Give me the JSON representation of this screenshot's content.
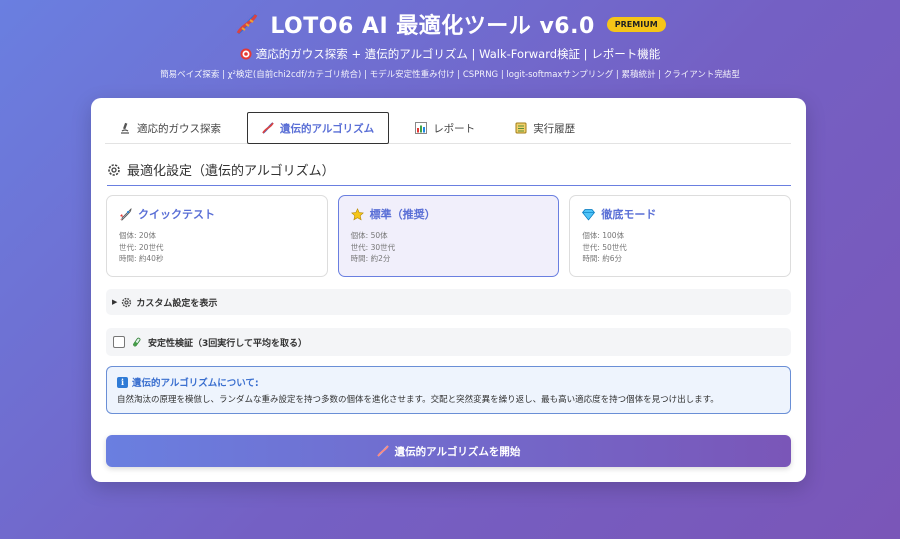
{
  "header": {
    "title": "LOTO6 AI 最適化ツール v6.0",
    "badge": "PREMIUM",
    "subtitle": "適応的ガウス探索 + 遺伝的アルゴリズム | Walk-Forward検証 | レポート機能",
    "features": "簡易ベイズ探索 | χ²検定(自前chi2cdf/カテゴリ統合) | モデル安定性重み付け | CSPRNG | logit-softmaxサンプリング | 累積統計 | クライアント完結型"
  },
  "tabs": [
    {
      "label": "適応的ガウス探索",
      "icon": "microscope-icon",
      "active": false
    },
    {
      "label": "遺伝的アルゴリズム",
      "icon": "dna-icon",
      "active": true
    },
    {
      "label": "レポート",
      "icon": "chart-icon",
      "active": false
    },
    {
      "label": "実行履歴",
      "icon": "ledger-icon",
      "active": false
    }
  ],
  "section": {
    "title": "最適化設定（遺伝的アルゴリズム）"
  },
  "modes": [
    {
      "title": "クイックテスト",
      "icon": "rocket-icon",
      "lines": [
        "個体: 20体",
        "世代: 20世代",
        "時間: 約40秒"
      ],
      "selected": false
    },
    {
      "title": "標準（推奨）",
      "icon": "star-icon",
      "lines": [
        "個体: 50体",
        "世代: 30世代",
        "時間: 約2分"
      ],
      "selected": true
    },
    {
      "title": "徹底モード",
      "icon": "gem-icon",
      "lines": [
        "個体: 100体",
        "世代: 50世代",
        "時間: 約6分"
      ],
      "selected": false
    }
  ],
  "custom": {
    "label": "カスタム設定を表示",
    "triangle": "▶"
  },
  "stability": {
    "label": "安定性検証（3回実行して平均を取る）",
    "checked": false
  },
  "info": {
    "title": "遺伝的アルゴリズムについて:",
    "icon_glyph": "i",
    "body": "自然淘汰の原理を模倣し、ランダムな重み設定を持つ多数の個体を進化させます。交配と突然変異を繰り返し、最も高い適応度を持つ個体を見つけ出します。"
  },
  "start_button": {
    "label": "遺伝的アルゴリズムを開始"
  },
  "colors": {
    "accent": "#6a7fe0",
    "accent2": "#7a56b8",
    "badge": "#f5c518",
    "info_border": "#6a8fd6"
  }
}
